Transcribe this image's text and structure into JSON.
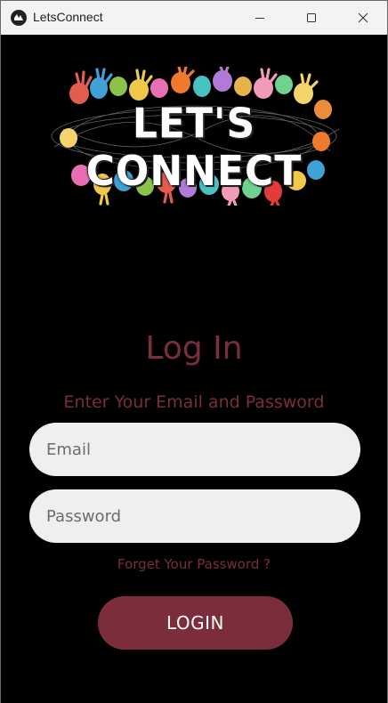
{
  "window": {
    "title": "LetsConnect",
    "minimize_icon": "minimize-icon",
    "maximize_icon": "maximize-icon",
    "close_icon": "close-icon"
  },
  "logo": {
    "text": "LET'S CONNECT"
  },
  "login": {
    "heading": "Log In",
    "subheading": "Enter Your Email and Password",
    "email_placeholder": "Email",
    "email_value": "",
    "password_placeholder": "Password",
    "password_value": "",
    "forgot_label": "Forget Your Password ?",
    "button_label": "LOGIN"
  },
  "colors": {
    "accent": "#7b2d3a",
    "background": "#000000",
    "field_bg": "#efefef",
    "titlebar_bg": "#f3f3f3"
  }
}
